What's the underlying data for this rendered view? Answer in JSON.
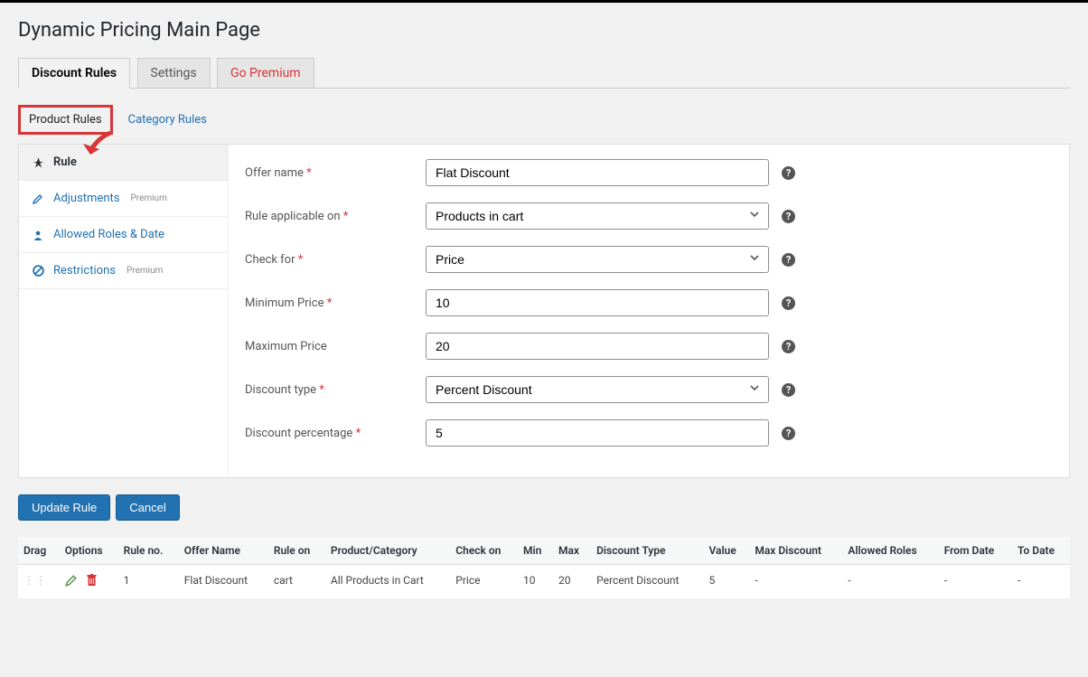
{
  "page_title": "Dynamic Pricing Main Page",
  "nav_tabs": {
    "discount_rules": "Discount Rules",
    "settings": "Settings",
    "go_premium": "Go Premium"
  },
  "sub_tabs": {
    "product_rules": "Product Rules",
    "category_rules": "Category Rules"
  },
  "side_menu": {
    "rule": "Rule",
    "adjustments": "Adjustments",
    "allowed_roles_date": "Allowed Roles & Date",
    "restrictions": "Restrictions",
    "premium_badge": "Premium"
  },
  "form": {
    "offer_name_label": "Offer name",
    "offer_name_value": "Flat Discount",
    "rule_applicable_label": "Rule applicable on",
    "rule_applicable_value": "Products in cart",
    "check_for_label": "Check for",
    "check_for_value": "Price",
    "minimum_price_label": "Minimum Price",
    "minimum_price_value": "10",
    "maximum_price_label": "Maximum Price",
    "maximum_price_value": "20",
    "discount_type_label": "Discount type",
    "discount_type_value": "Percent Discount",
    "discount_percentage_label": "Discount percentage",
    "discount_percentage_value": "5",
    "required_mark": "*"
  },
  "buttons": {
    "update_rule": "Update Rule",
    "cancel": "Cancel"
  },
  "table": {
    "headers": {
      "drag": "Drag",
      "options": "Options",
      "rule_no": "Rule no.",
      "offer_name": "Offer Name",
      "rule_on": "Rule on",
      "product_category": "Product/Category",
      "check_on": "Check on",
      "min": "Min",
      "max": "Max",
      "discount_type": "Discount Type",
      "value": "Value",
      "max_discount": "Max Discount",
      "allowed_roles": "Allowed Roles",
      "from_date": "From Date",
      "to_date": "To Date"
    },
    "row": {
      "rule_no": "1",
      "offer_name": "Flat Discount",
      "rule_on": "cart",
      "product_category": "All Products in Cart",
      "check_on": "Price",
      "min": "10",
      "max": "20",
      "discount_type": "Percent Discount",
      "value": "5",
      "max_discount": "-",
      "allowed_roles": "-",
      "from_date": "-",
      "to_date": "-"
    }
  }
}
